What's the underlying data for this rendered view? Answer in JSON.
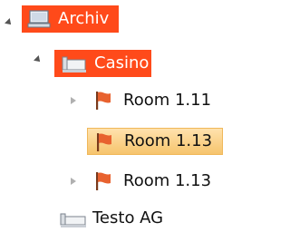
{
  "tree": {
    "nodes": [
      {
        "label": "Archiv",
        "icon": "computer-icon",
        "selected": "red",
        "expanded": true
      },
      {
        "label": "Casino",
        "icon": "folder-building-icon",
        "selected": "red",
        "expanded": true
      },
      {
        "label": "Room 1.11",
        "icon": "flag-icon",
        "selected": "none",
        "expanded": false
      },
      {
        "label": "Room 1.13",
        "icon": "flag-icon",
        "selected": "highlight",
        "expanded": false
      },
      {
        "label": "Room 1.13",
        "icon": "flag-icon",
        "selected": "none",
        "expanded": false
      },
      {
        "label": "Testo AG",
        "icon": "building-icon",
        "selected": "none",
        "expanded": false
      }
    ]
  },
  "colors": {
    "selection_red": "#ff4a1a",
    "selection_highlight": "#f6c46d",
    "flag_orange": "#e8622f"
  }
}
